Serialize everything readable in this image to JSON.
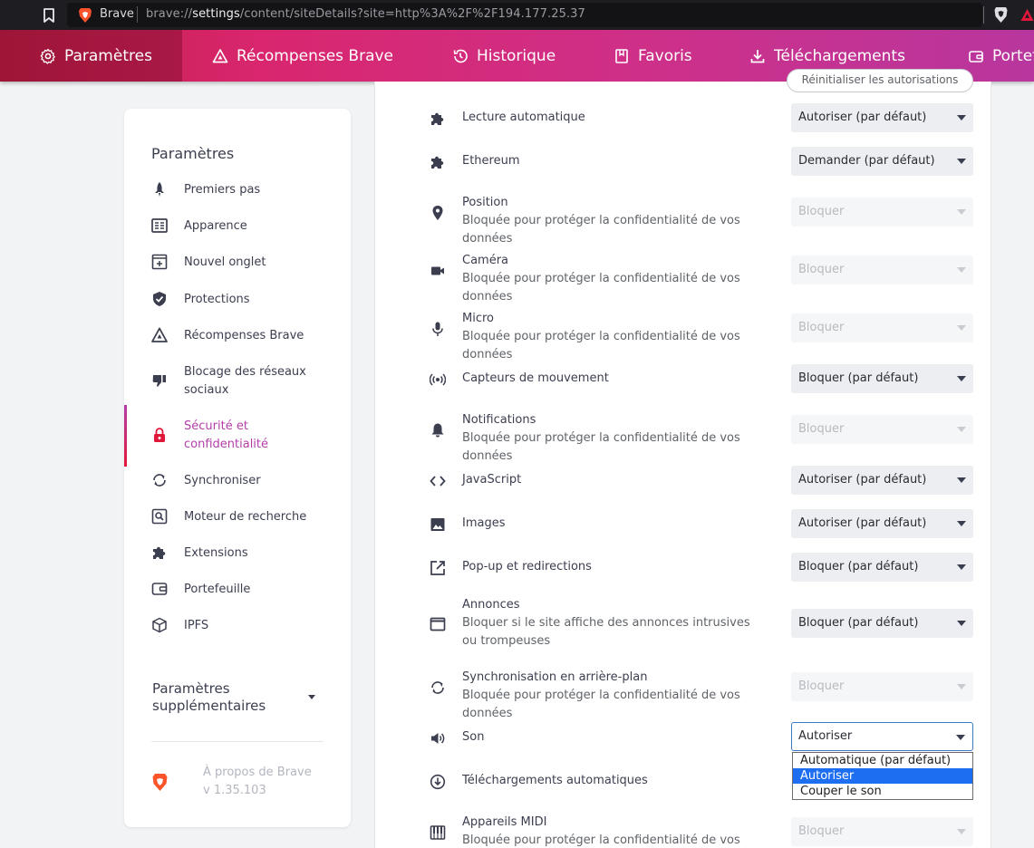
{
  "browser": {
    "app_name": "Brave",
    "url_prefix": "brave://",
    "url_host": "settings",
    "url_rest": "/content/siteDetails?site=http%3A%2F%2F194.177.25.37"
  },
  "topnav": {
    "items": [
      {
        "label": "Paramètres",
        "icon": "gear-icon"
      },
      {
        "label": "Récompenses Brave",
        "icon": "rewards-triangle-icon"
      },
      {
        "label": "Historique",
        "icon": "history-icon"
      },
      {
        "label": "Favoris",
        "icon": "bookmark-icon"
      },
      {
        "label": "Téléchargements",
        "icon": "download-icon"
      },
      {
        "label": "Portefeuille",
        "icon": "wallet-icon"
      }
    ]
  },
  "sidebar": {
    "title": "Paramètres",
    "items": [
      {
        "label": "Premiers pas",
        "icon": "rocket-icon"
      },
      {
        "label": "Apparence",
        "icon": "appearance-icon"
      },
      {
        "label": "Nouvel onglet",
        "icon": "new-tab-icon"
      },
      {
        "label": "Protections",
        "icon": "shield-check-icon"
      },
      {
        "label": "Récompenses Brave",
        "icon": "rewards-triangle-icon"
      },
      {
        "label": "Blocage des réseaux sociaux",
        "icon": "thumbs-down-icon"
      },
      {
        "label": "Sécurité et confidentialité",
        "icon": "lock-icon"
      },
      {
        "label": "Synchroniser",
        "icon": "sync-icon"
      },
      {
        "label": "Moteur de recherche",
        "icon": "search-icon"
      },
      {
        "label": "Extensions",
        "icon": "puzzle-icon"
      },
      {
        "label": "Portefeuille",
        "icon": "wallet-icon"
      },
      {
        "label": "IPFS",
        "icon": "cube-icon"
      }
    ],
    "more_title": "Paramètres supplémentaires",
    "about_label": "À propos de Brave",
    "version": "v 1.35.103"
  },
  "main": {
    "reset_label": "Réinitialiser les autorisations",
    "permissions": [
      {
        "title": "Lecture automatique",
        "subtitle": "",
        "value": "Autoriser (par défaut)",
        "icon": "puzzle-icon"
      },
      {
        "title": "Ethereum",
        "subtitle": "",
        "value": "Demander (par défaut)",
        "icon": "puzzle-icon"
      },
      {
        "title": "Position",
        "subtitle": "Bloquée pour protéger la confidentialité de vos données",
        "value": "Bloquer",
        "icon": "location-pin-icon"
      },
      {
        "title": "Caméra",
        "subtitle": "Bloquée pour protéger la confidentialité de vos données",
        "value": "Bloquer",
        "icon": "camera-icon"
      },
      {
        "title": "Micro",
        "subtitle": "Bloquée pour protéger la confidentialité de vos données",
        "value": "Bloquer",
        "icon": "microphone-icon"
      },
      {
        "title": "Capteurs de mouvement",
        "subtitle": "",
        "value": "Bloquer (par défaut)",
        "icon": "motion-sensor-icon"
      },
      {
        "title": "Notifications",
        "subtitle": "Bloquée pour protéger la confidentialité de vos données",
        "value": "Bloquer",
        "icon": "bell-icon"
      },
      {
        "title": "JavaScript",
        "subtitle": "",
        "value": "Autoriser (par défaut)",
        "icon": "code-icon"
      },
      {
        "title": "Images",
        "subtitle": "",
        "value": "Autoriser (par défaut)",
        "icon": "image-icon"
      },
      {
        "title": "Pop-up et redirections",
        "subtitle": "",
        "value": "Bloquer (par défaut)",
        "icon": "popup-icon"
      },
      {
        "title": "Annonces",
        "subtitle": "Bloquer si le site affiche des annonces intrusives ou trompeuses",
        "value": "Bloquer (par défaut)",
        "icon": "ads-window-icon"
      },
      {
        "title": "Synchronisation en arrière-plan",
        "subtitle": "Bloquée pour protéger la confidentialité de vos données",
        "value": "Bloquer",
        "icon": "sync-icon"
      },
      {
        "title": "Son",
        "subtitle": "",
        "value": "Autoriser",
        "icon": "speaker-icon"
      },
      {
        "title": "Téléchargements automatiques",
        "subtitle": "",
        "value": "",
        "icon": "download-circle-icon"
      },
      {
        "title": "Appareils MIDI",
        "subtitle": "Bloquée pour protéger la confidentialité de vos données",
        "value": "Bloquer",
        "icon": "piano-icon"
      }
    ],
    "sound_dropdown_options": [
      "Automatique (par défaut)",
      "Autoriser",
      "Couper le son"
    ],
    "sound_dropdown_selected": "Autoriser"
  },
  "colors": {
    "nav_gradient_start": "#bf1e44",
    "nav_gradient_end": "#b8369e",
    "active_accent": "#b33ea8",
    "dropdown_highlight": "#1e6ef2"
  }
}
